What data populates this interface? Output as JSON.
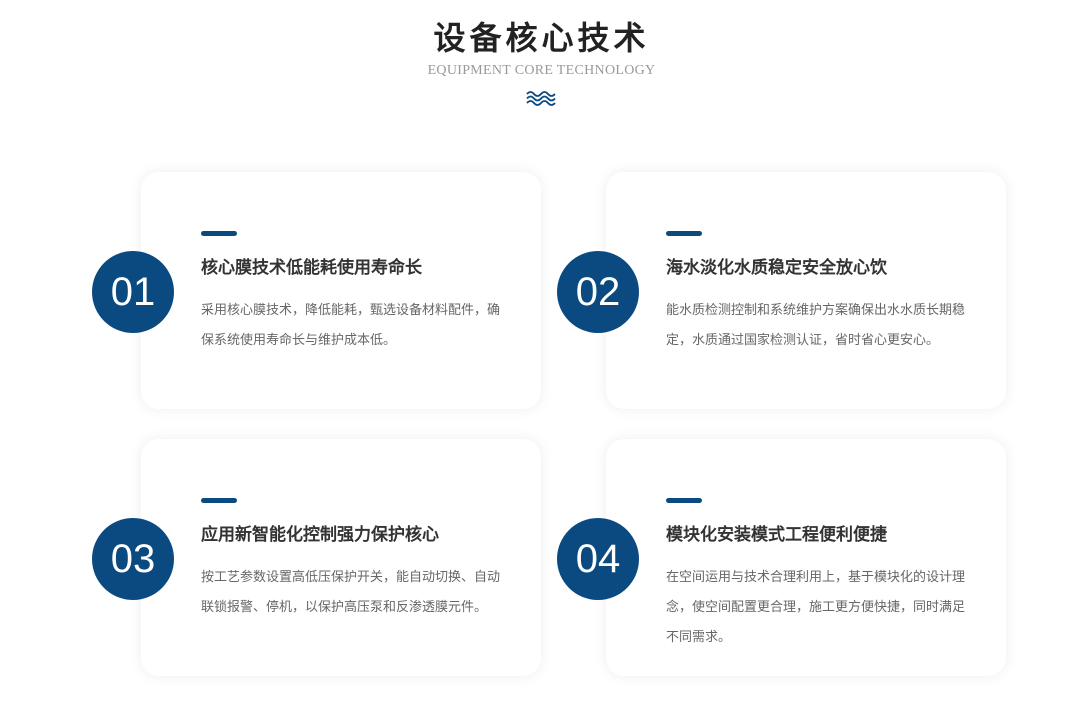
{
  "header": {
    "title": "设备核心技术",
    "subtitle": "EQUIPMENT CORE TECHNOLOGY",
    "decoration_icon": "wave-icon"
  },
  "colors": {
    "accent": "#0a4a80",
    "title": "#222222",
    "subtitle": "#999999",
    "body_text": "#666666"
  },
  "features": [
    {
      "number": "01",
      "title": "核心膜技术低能耗使用寿命长",
      "description": "采用核心膜技术，降低能耗，甄选设备材料配件，确保系统使用寿命长与维护成本低。"
    },
    {
      "number": "02",
      "title": "海水淡化水质稳定安全放心饮",
      "description": "能水质检测控制和系统维护方案确保出水水质长期稳定，水质通过国家检测认证，省时省心更安心。"
    },
    {
      "number": "03",
      "title": "应用新智能化控制强力保护核心",
      "description": "按工艺参数设置高低压保护开关，能自动切换、自动联锁报警、停机，以保护高压泵和反渗透膜元件。"
    },
    {
      "number": "04",
      "title": "模块化安装模式工程便利便捷",
      "description": "在空间运用与技术合理利用上，基于模块化的设计理念，使空间配置更合理，施工更方便快捷，同时满足不同需求。"
    }
  ]
}
